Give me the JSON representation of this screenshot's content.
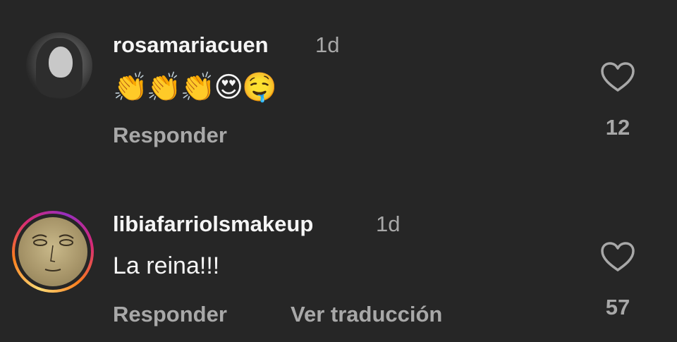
{
  "comments": [
    {
      "username": "rosamariacuen",
      "time": "1d",
      "text": "👏👏👏😍🤤",
      "reply_label": "Responder",
      "likes": "12",
      "heart_icon": "heart-outline-icon"
    },
    {
      "username": "libiafarriolsmakeup",
      "time": "1d",
      "text": "La reina!!!",
      "reply_label": "Responder",
      "translate_label": "Ver traducción",
      "likes": "57",
      "heart_icon": "heart-outline-icon"
    }
  ],
  "colors": {
    "background": "#262626",
    "primary_text": "#f5f5f5",
    "secondary_text": "#a8a8a8"
  }
}
